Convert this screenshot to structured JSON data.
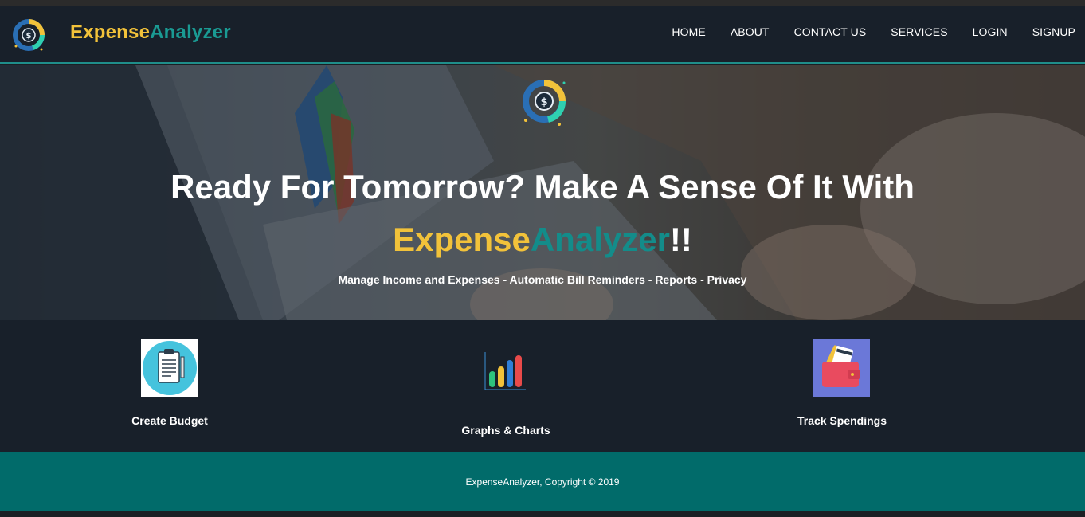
{
  "brand": {
    "part1": "Expense",
    "part2": "Analyzer"
  },
  "nav": [
    "HOME",
    "ABOUT",
    "CONTACT US",
    "SERVICES",
    "LOGIN",
    "SIGNUP"
  ],
  "hero": {
    "title_line1": "Ready For Tomorrow? Make A Sense Of It With",
    "title_brand1": "Expense",
    "title_brand2": "Analyzer",
    "title_suffix": "!!",
    "subtitle": "Manage Income and Expenses - Automatic Bill Reminders - Reports - Privacy"
  },
  "features": [
    {
      "label": "Create Budget",
      "icon": "clipboard-icon"
    },
    {
      "label": "Graphs & Charts",
      "icon": "bar-chart-icon"
    },
    {
      "label": "Track Spendings",
      "icon": "wallet-icon"
    }
  ],
  "footer": {
    "text": "ExpenseAnalyzer, Copyright © 2019"
  },
  "colors": {
    "accent_yellow": "#f2c23a",
    "accent_teal": "#1a9a93",
    "navbar_bg": "#18202a",
    "footer_bg": "#016b6a"
  }
}
